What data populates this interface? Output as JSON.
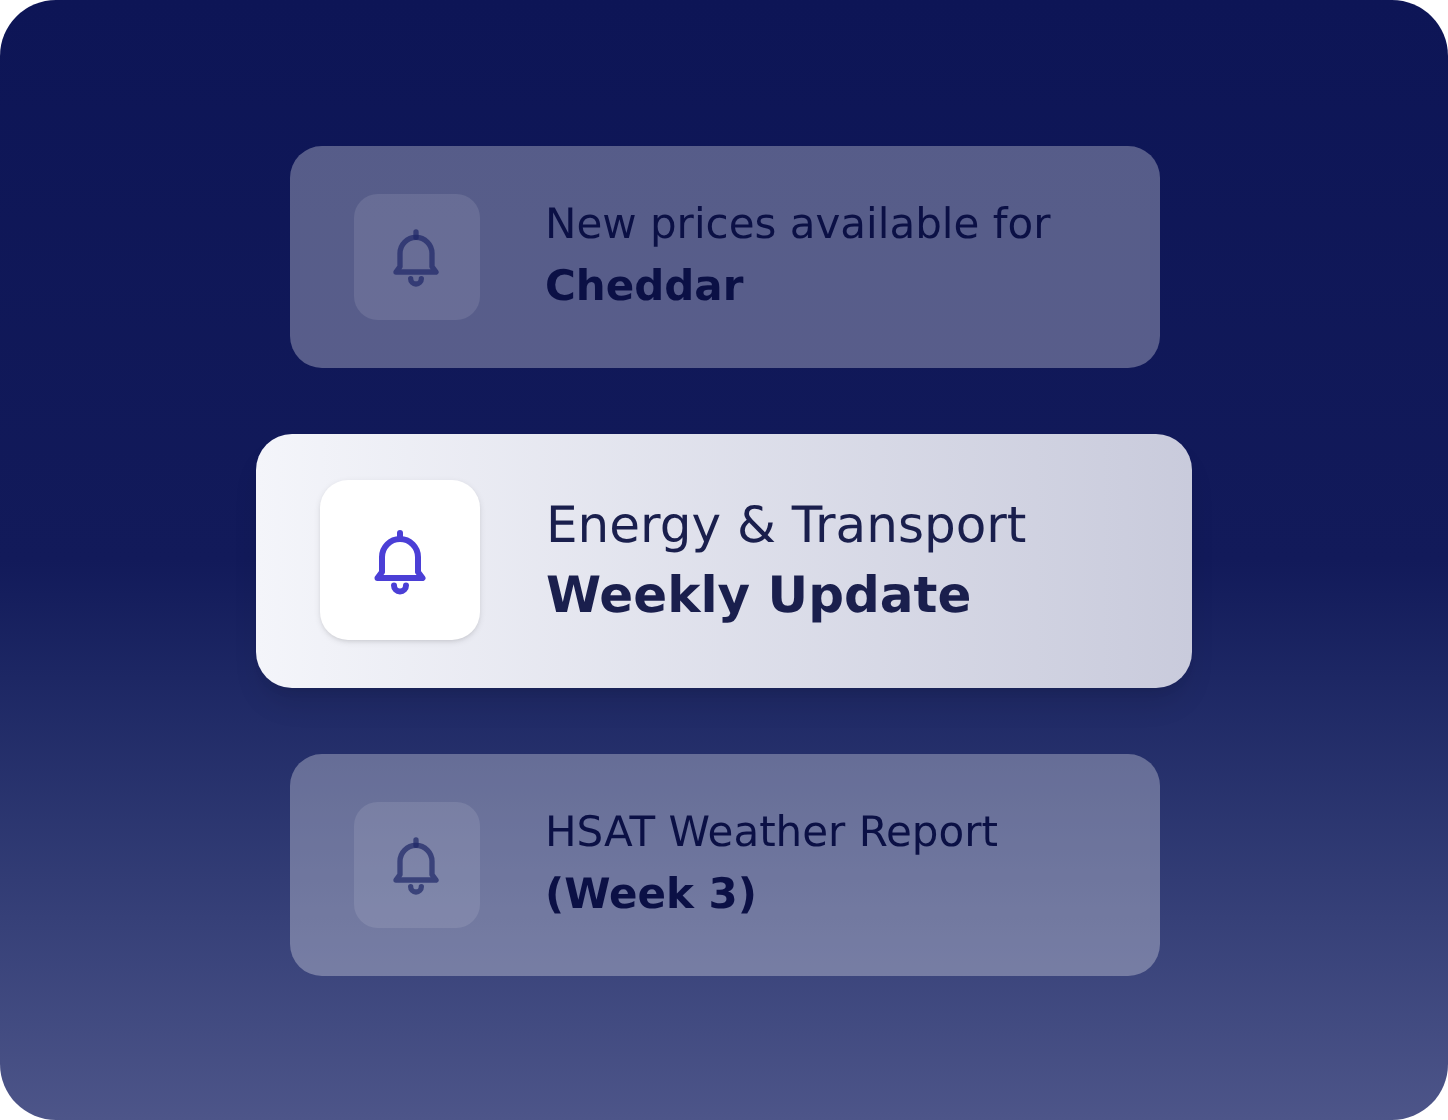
{
  "notifications": [
    {
      "line_1": "New prices available for",
      "line_2": "Cheddar",
      "selected": false
    },
    {
      "line_1": "Energy & Transport",
      "line_2": "Weekly Update",
      "selected": true
    },
    {
      "line_1": "HSAT Weather Report",
      "line_2": "(Week 3)",
      "selected": false
    }
  ]
}
